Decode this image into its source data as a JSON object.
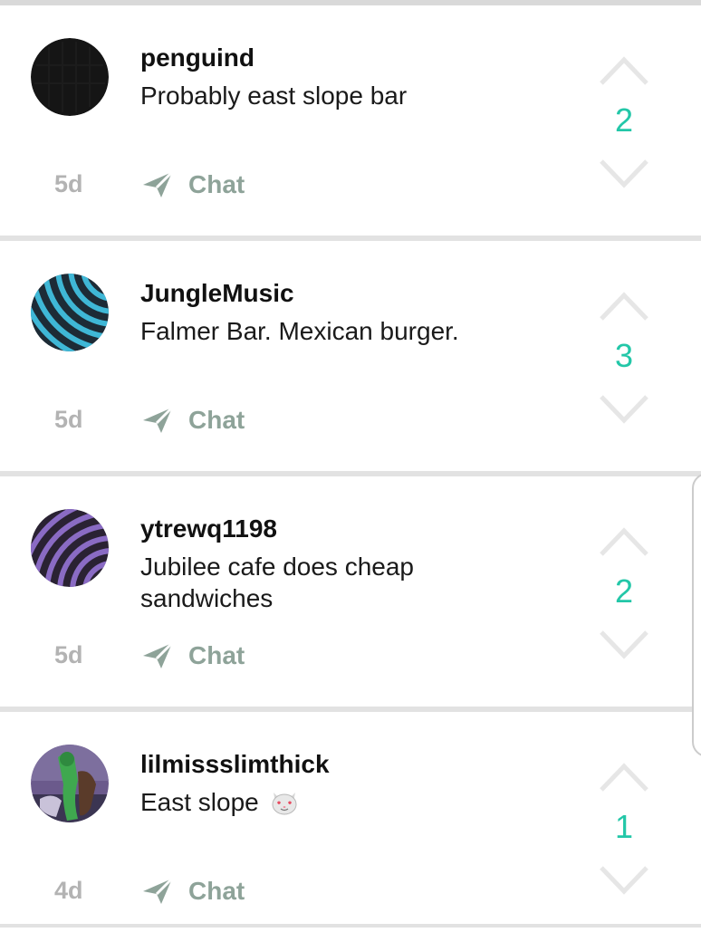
{
  "comments": [
    {
      "username": "penguind",
      "text": "Probably east slope bar",
      "age": "5d",
      "chat_label": "Chat",
      "score": "2",
      "avatar_icon": "black-circle-avatar"
    },
    {
      "username": "JungleMusic",
      "text": "Falmer Bar. Mexican burger.",
      "age": "5d",
      "chat_label": "Chat",
      "score": "3",
      "avatar_icon": "blue-wave-avatar"
    },
    {
      "username": "ytrewq1198",
      "text": "Jubilee cafe does cheap sandwiches",
      "age": "5d",
      "chat_label": "Chat",
      "score": "2",
      "avatar_icon": "purple-wave-avatar"
    },
    {
      "username": "lilmissslimthick",
      "text": "East slope",
      "emoji": "heart-eyes-cat-emoji",
      "age": "4d",
      "chat_label": "Chat",
      "score": "1",
      "avatar_icon": "photo-avatar"
    }
  ],
  "colors": {
    "score": "#23c7a8",
    "chat": "#8ea399",
    "age": "#b3b3b3",
    "vote_arrow": "#e6e6e6",
    "avatar_blue": "#3fb7d6",
    "avatar_purple": "#8a6bc4"
  }
}
